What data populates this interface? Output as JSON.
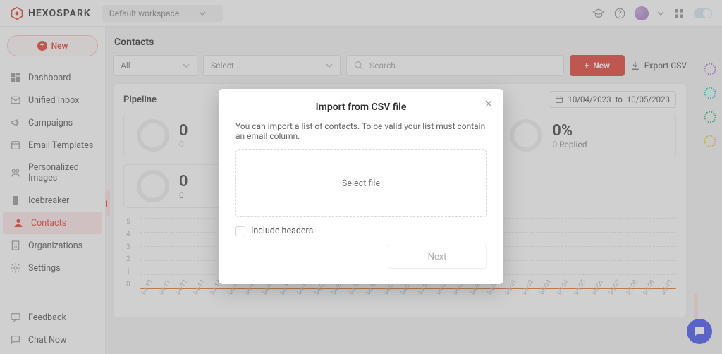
{
  "brand": "HEXOSPARK",
  "workspace": {
    "label": "Default workspace"
  },
  "sidebar": {
    "new_label": "New",
    "items": [
      {
        "label": "Dashboard"
      },
      {
        "label": "Unified Inbox"
      },
      {
        "label": "Campaigns"
      },
      {
        "label": "Email Templates"
      },
      {
        "label": "Personalized Images"
      },
      {
        "label": "Icebreaker"
      },
      {
        "label": "Contacts"
      },
      {
        "label": "Organizations"
      },
      {
        "label": "Settings"
      }
    ],
    "bottom": [
      {
        "label": "Feedback"
      },
      {
        "label": "Chat Now"
      }
    ]
  },
  "page": {
    "title": "Contacts",
    "filter_all": "All",
    "filter_select_placeholder": "Select...",
    "search_placeholder": "Search...",
    "new_btn": "New",
    "export_label": "Export CSV"
  },
  "pipeline": {
    "title": "Pipeline",
    "date_from": "10/04/2023",
    "date_to_label": "to",
    "date_to": "10/05/2023",
    "stats": [
      {
        "value": "0",
        "sub": "0"
      },
      {
        "value": "0%",
        "sub": "0 Replied"
      },
      {
        "value": "0",
        "sub": "0"
      }
    ]
  },
  "chart_data": {
    "type": "line",
    "title": "",
    "xlabel": "",
    "ylabel": "",
    "ylim": [
      0,
      5
    ],
    "y_ticks": [
      5,
      4,
      3,
      2,
      1,
      0
    ],
    "categories": [
      "04-10",
      "04-11",
      "04-12",
      "04-13",
      "04-14",
      "04-15",
      "04-16",
      "04-17",
      "04-18",
      "04-19",
      "04-20",
      "04-21",
      "04-22",
      "04-23",
      "04-24",
      "04-25",
      "04-26",
      "04-27",
      "04-28",
      "04-29",
      "04-30",
      "05-01",
      "05-02",
      "05-03",
      "05-04",
      "05-05",
      "05-06",
      "05-07",
      "05-08",
      "05-09",
      "05-10"
    ],
    "values": [
      0,
      0,
      0,
      0,
      0,
      0,
      0,
      0,
      0,
      0,
      0,
      0,
      0,
      0,
      0,
      0,
      0,
      0,
      0,
      0,
      0,
      0,
      0,
      0,
      0,
      0,
      0,
      0,
      0,
      0,
      0
    ]
  },
  "modal": {
    "title": "Import from CSV file",
    "description": "You can import a list of contacts. To be valid your list must contain an email column.",
    "dropzone_label": "Select file",
    "include_headers_label": "Include headers",
    "next_label": "Next"
  }
}
